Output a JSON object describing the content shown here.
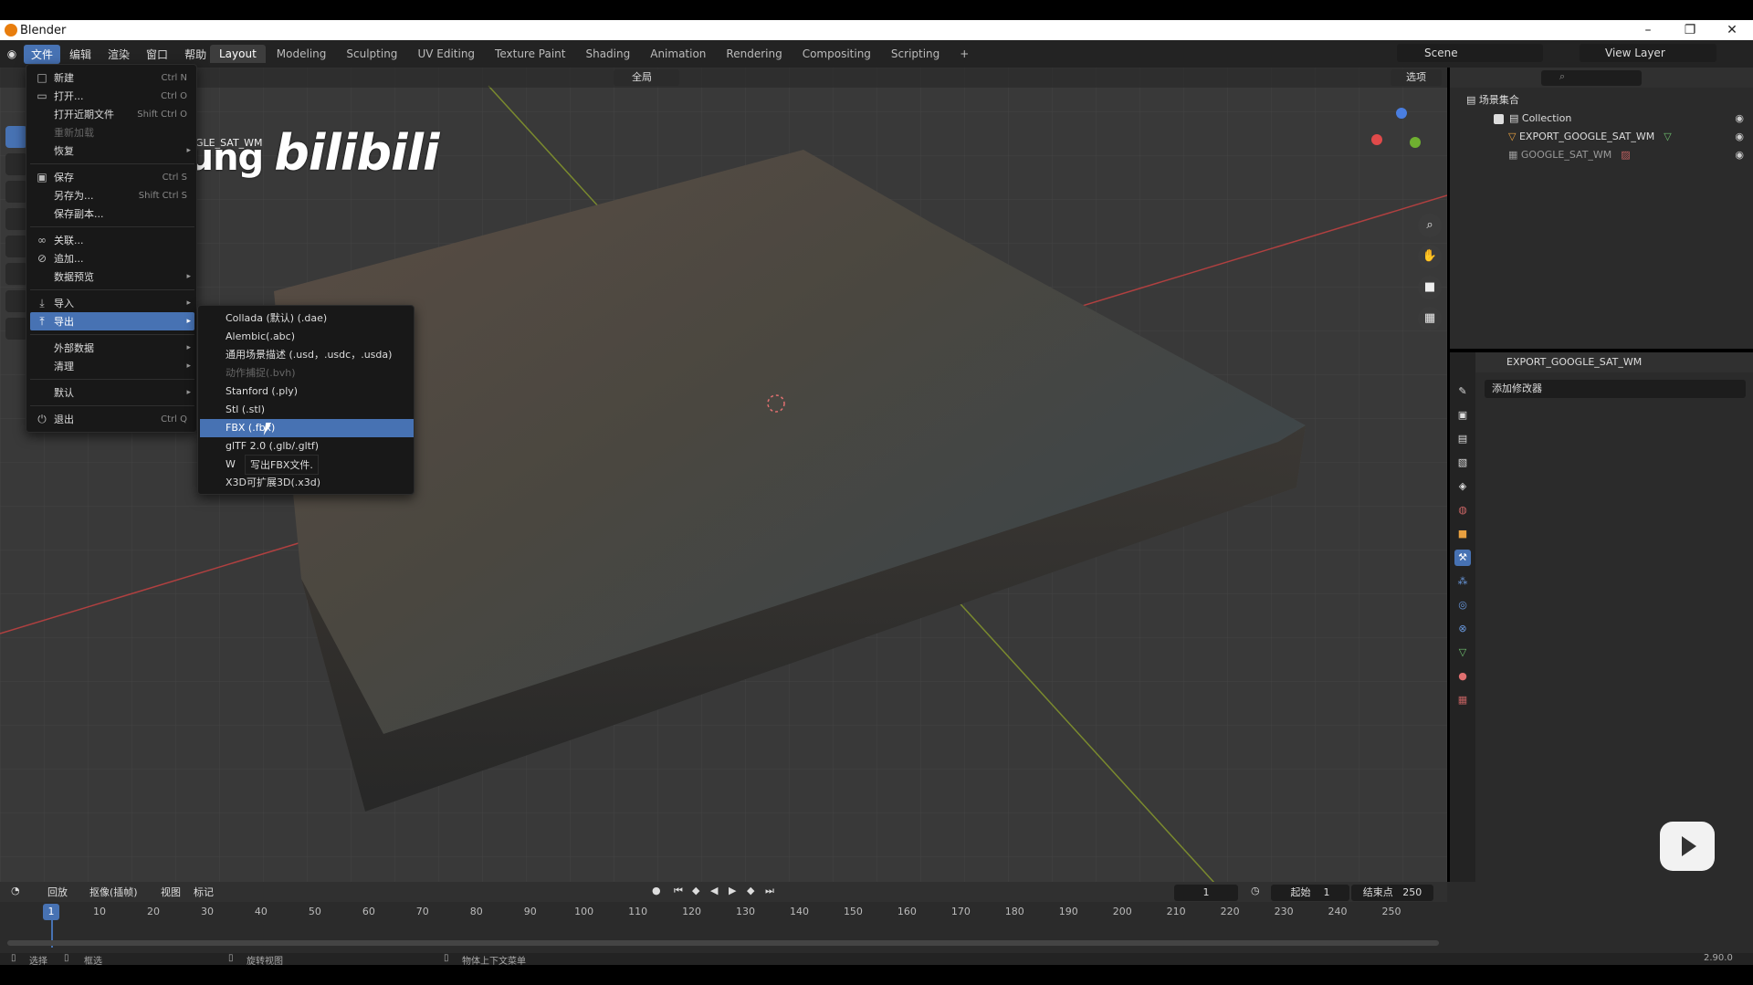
{
  "window": {
    "title": "Blender",
    "controls": [
      "–",
      "❐",
      "✕"
    ]
  },
  "menubar": {
    "items": [
      "文件",
      "编辑",
      "渲染",
      "窗口",
      "帮助"
    ],
    "workspaces": [
      "Layout",
      "Modeling",
      "Sculpting",
      "UV Editing",
      "Texture Paint",
      "Shading",
      "Animation",
      "Rendering",
      "Compositing",
      "Scripting",
      "+"
    ],
    "scene": "Scene",
    "view_layer": "View Layer"
  },
  "viewport": {
    "global_label": "全局",
    "options_label": "选项",
    "object_label": "GLE_SAT_WM",
    "watermark": "JackSheung",
    "watermark_brand": "bilibili"
  },
  "file_menu": {
    "new": {
      "label": "新建",
      "shortcut": "Ctrl N"
    },
    "open": {
      "label": "打开...",
      "shortcut": "Ctrl O"
    },
    "open_recent": {
      "label": "打开近期文件",
      "shortcut": "Shift Ctrl O"
    },
    "revert": "重新加载",
    "recover": "恢复",
    "save": {
      "label": "保存",
      "shortcut": "Ctrl S"
    },
    "save_as": {
      "label": "另存为...",
      "shortcut": "Shift Ctrl S"
    },
    "save_copy": "保存副本...",
    "link": "关联...",
    "append": "追加...",
    "data_previews": "数据预览",
    "import": "导入",
    "export": "导出",
    "external_data": "外部数据",
    "clean_up": "清理",
    "defaults": "默认",
    "quit": {
      "label": "退出",
      "shortcut": "Ctrl Q"
    }
  },
  "export_menu": {
    "items": [
      "Collada (默认) (.dae)",
      "Alembic(.abc)",
      "通用场景描述 (.usd，.usdc，.usda)",
      "动作捕捉(.bvh)",
      "Stanford (.ply)",
      "Stl (.stl)",
      "FBX (.fbx)",
      "glTF 2.0 (.glb/.gltf)",
      "W",
      "X3D可扩展3D(.x3d)"
    ],
    "tooltip": "写出FBX文件."
  },
  "outliner": {
    "title": "场景集合",
    "items": [
      {
        "name": "Collection"
      },
      {
        "name": "EXPORT_GOOGLE_SAT_WM"
      },
      {
        "name": "GOOGLE_SAT_WM"
      }
    ]
  },
  "properties": {
    "object_name": "EXPORT_GOOGLE_SAT_WM",
    "add_modifier": "添加修改器"
  },
  "timeline": {
    "menus": [
      "回放",
      "抠像(插帧)",
      "视图",
      "标记"
    ],
    "current_frame": "1",
    "start_label": "起始",
    "start_value": "1",
    "end_label": "结束点",
    "end_value": "250",
    "ruler": [
      "1",
      "10",
      "20",
      "30",
      "40",
      "50",
      "60",
      "70",
      "80",
      "90",
      "100",
      "110",
      "120",
      "130",
      "140",
      "150",
      "160",
      "170",
      "180",
      "190",
      "200",
      "210",
      "220",
      "230",
      "240",
      "250"
    ]
  },
  "statusbar": {
    "select": "选择",
    "box_select": "框选",
    "rotate_view": "旋转视图",
    "context_menu": "物体上下文菜单",
    "version": "2.90.0"
  },
  "colors": {
    "accent": "#4772b3",
    "panel": "#2b2b2b",
    "header": "#303030",
    "viewport": "#393939"
  }
}
